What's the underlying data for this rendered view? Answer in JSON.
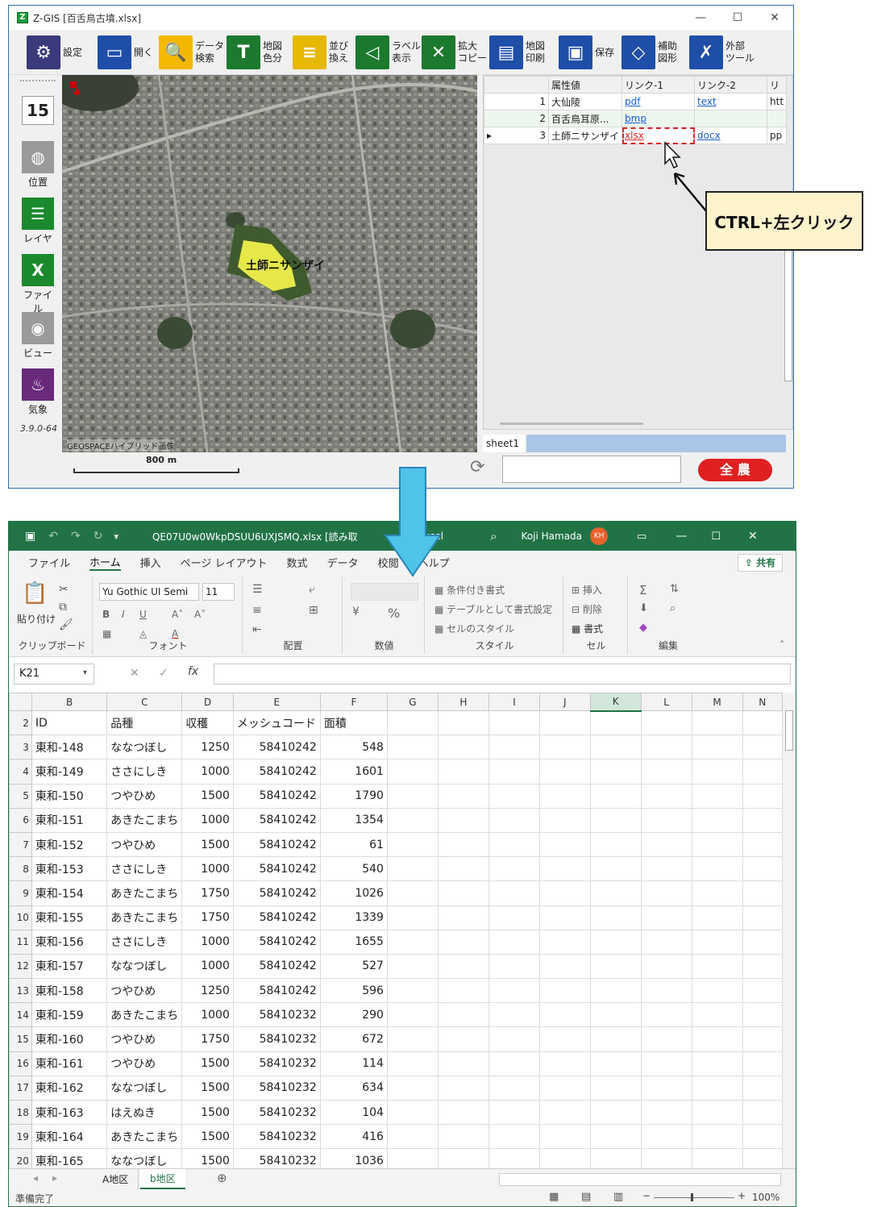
{
  "zgis": {
    "title": "Z-GIS [百舌鳥古墳.xlsx]",
    "toolbar": [
      {
        "icon": "gear-icon",
        "label": "設定",
        "color": "#3a3a7c",
        "glyph": "⚙"
      },
      {
        "icon": "folder-open-icon",
        "label": "開く",
        "color": "#1f4ea8",
        "glyph": "▭"
      },
      {
        "icon": "search-icon",
        "label": "データ\n検索",
        "color": "#f3b800",
        "glyph": "🔍"
      },
      {
        "icon": "map-color-icon",
        "label": "地図\n色分",
        "color": "#1b7a2e",
        "glyph": "T"
      },
      {
        "icon": "sort-icon",
        "label": "並び\n換え",
        "color": "#e6b800",
        "glyph": "≡"
      },
      {
        "icon": "label-icon",
        "label": "ラベル\n表示",
        "color": "#1b7a2e",
        "glyph": "◁"
      },
      {
        "icon": "enlarge-copy-icon",
        "label": "拡大\nコピー",
        "color": "#1b7a2e",
        "glyph": "✕"
      },
      {
        "icon": "print-icon",
        "label": "地図\n印刷",
        "color": "#1f4ea8",
        "glyph": "▤"
      },
      {
        "icon": "save-icon",
        "label": "保存",
        "color": "#1f4ea8",
        "glyph": "▣"
      },
      {
        "icon": "shape-icon",
        "label": "補助\n図形",
        "color": "#1f4ea8",
        "glyph": "◇"
      },
      {
        "icon": "tools-icon",
        "label": "外部\nツール",
        "color": "#1f4ea8",
        "glyph": "✗"
      }
    ],
    "sidebar": {
      "zoom": "15",
      "items": [
        {
          "icon": "globe-icon",
          "label": "位置",
          "color": "#9a9a9a",
          "glyph": "◍"
        },
        {
          "icon": "layer-icon",
          "label": "レイヤ",
          "color": "#1b8a2e",
          "glyph": "☰"
        },
        {
          "icon": "file-icon",
          "label": "ファイル",
          "color": "#1b8a2e",
          "glyph": "X"
        },
        {
          "icon": "eye-icon",
          "label": "ビュー",
          "color": "#9a9a9a",
          "glyph": "◉"
        },
        {
          "icon": "weather-icon",
          "label": "気象",
          "color": "#6a2a7c",
          "glyph": "♨"
        }
      ],
      "version": "3.9.0-64"
    },
    "map": {
      "kofun_label": "土師ニサンザイ",
      "credit": "GEOSPACEハイブリッド画像",
      "scale": "800 m"
    },
    "table": {
      "headers": [
        "属性値",
        "リンク-1",
        "リンク-2",
        "リ"
      ],
      "rows": [
        {
          "no": "1",
          "name": "大仙陵",
          "l1": "pdf",
          "l2": "text",
          "l3": "htt"
        },
        {
          "no": "2",
          "name": "百舌鳥耳原...",
          "l1": "bmp",
          "l2": "",
          "l3": ""
        },
        {
          "no": "3",
          "name": "土師ニサンザイ",
          "l1": "xlsx",
          "l2": "docx",
          "l3": "pp"
        }
      ],
      "sheet_tab": "sheet1"
    },
    "callout": "CTRL+左クリック",
    "brand": "全 農"
  },
  "excel": {
    "title": "QE07U0w0WkpDSUU6UXJSMQ.xlsx  [読み取",
    "title_suffix": "]  -  Excel",
    "user": "Koji Hamada",
    "user_initials": "KH",
    "tabs": [
      "ファイル",
      "ホーム",
      "挿入",
      "ページ レイアウト",
      "数式",
      "データ",
      "校閲",
      "ヘルプ"
    ],
    "share": "共有",
    "ribbon": {
      "clipboard": "クリップボード",
      "paste": "貼り付け",
      "font_name": "Yu Gothic UI Semi",
      "font_size": "11",
      "font": "フォント",
      "align": "配置",
      "number": "数値",
      "style": "スタイル",
      "cond_format": "条件付き書式",
      "table_format": "テーブルとして書式設定",
      "cell_style": "セルのスタイル",
      "cells": "セル",
      "insert": "挿入",
      "delete": "削除",
      "format": "書式",
      "edit": "編集"
    },
    "name_box": "K21",
    "columns": [
      "B",
      "C",
      "D",
      "E",
      "F",
      "G",
      "H",
      "I",
      "J",
      "K",
      "L",
      "M",
      "N"
    ],
    "header_row": {
      "row": "2",
      "cells": [
        "ID",
        "品種",
        "収穫",
        "メッシュコード",
        "面積"
      ]
    },
    "rows": [
      {
        "r": "3",
        "id": "東和-148",
        "var": "ななつぼし",
        "yield": "1250",
        "mesh": "58410242",
        "area": "548"
      },
      {
        "r": "4",
        "id": "東和-149",
        "var": "ささにしき",
        "yield": "1000",
        "mesh": "58410242",
        "area": "1601"
      },
      {
        "r": "5",
        "id": "東和-150",
        "var": "つやひめ",
        "yield": "1500",
        "mesh": "58410242",
        "area": "1790"
      },
      {
        "r": "6",
        "id": "東和-151",
        "var": "あきたこまち",
        "yield": "1000",
        "mesh": "58410242",
        "area": "1354"
      },
      {
        "r": "7",
        "id": "東和-152",
        "var": "つやひめ",
        "yield": "1500",
        "mesh": "58410242",
        "area": "61"
      },
      {
        "r": "8",
        "id": "東和-153",
        "var": "ささにしき",
        "yield": "1000",
        "mesh": "58410242",
        "area": "540"
      },
      {
        "r": "9",
        "id": "東和-154",
        "var": "あきたこまち",
        "yield": "1750",
        "mesh": "58410242",
        "area": "1026"
      },
      {
        "r": "10",
        "id": "東和-155",
        "var": "あきたこまち",
        "yield": "1750",
        "mesh": "58410242",
        "area": "1339"
      },
      {
        "r": "11",
        "id": "東和-156",
        "var": "ささにしき",
        "yield": "1000",
        "mesh": "58410242",
        "area": "1655"
      },
      {
        "r": "12",
        "id": "東和-157",
        "var": "ななつぼし",
        "yield": "1000",
        "mesh": "58410242",
        "area": "527"
      },
      {
        "r": "13",
        "id": "東和-158",
        "var": "つやひめ",
        "yield": "1250",
        "mesh": "58410242",
        "area": "596"
      },
      {
        "r": "14",
        "id": "東和-159",
        "var": "あきたこまち",
        "yield": "1000",
        "mesh": "58410232",
        "area": "290"
      },
      {
        "r": "15",
        "id": "東和-160",
        "var": "つやひめ",
        "yield": "1750",
        "mesh": "58410232",
        "area": "672"
      },
      {
        "r": "16",
        "id": "東和-161",
        "var": "つやひめ",
        "yield": "1500",
        "mesh": "58410232",
        "area": "114"
      },
      {
        "r": "17",
        "id": "東和-162",
        "var": "ななつぼし",
        "yield": "1500",
        "mesh": "58410232",
        "area": "634"
      },
      {
        "r": "18",
        "id": "東和-163",
        "var": "はえぬき",
        "yield": "1500",
        "mesh": "58410232",
        "area": "104"
      },
      {
        "r": "19",
        "id": "東和-164",
        "var": "あきたこまち",
        "yield": "1500",
        "mesh": "58410232",
        "area": "416"
      },
      {
        "r": "20",
        "id": "東和-165",
        "var": "ななつぼし",
        "yield": "1500",
        "mesh": "58410232",
        "area": "1036"
      }
    ],
    "sheets": [
      "A地区",
      "b地区"
    ],
    "status": "準備完了",
    "zoom": "100%"
  },
  "colors": {
    "excel_green": "#217346",
    "arrow": "#4fc3e8",
    "link": "#1a5fd0",
    "callout_bg": "#fff3cc",
    "highlight": "#d62828"
  }
}
